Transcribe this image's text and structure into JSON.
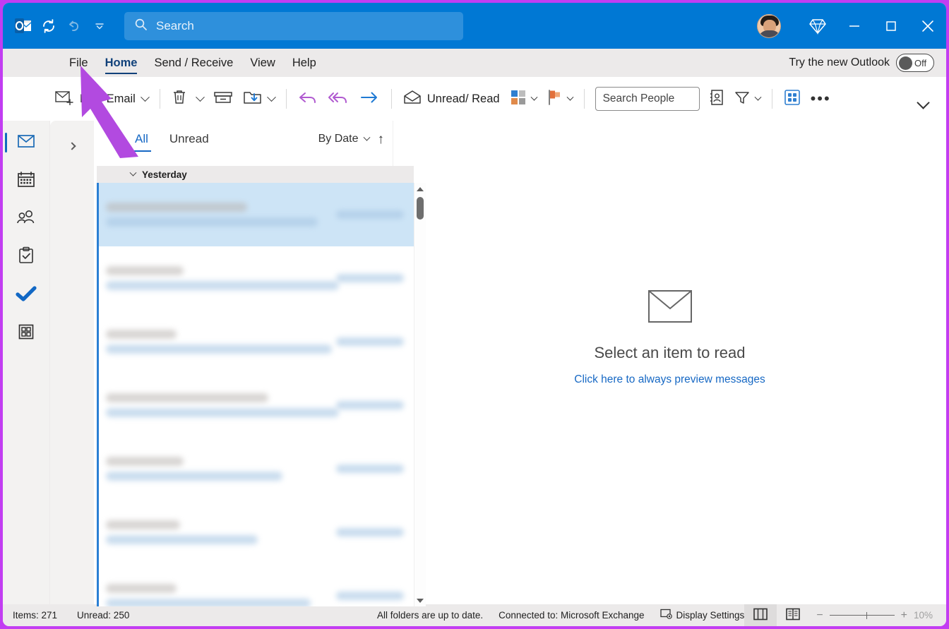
{
  "window": {
    "accent_border_color": "#c23df2",
    "titlebar_color": "#0078d4"
  },
  "titlebar": {
    "app_icon": "outlook-logo-icon",
    "sync_icon": "sync-refresh-icon",
    "undo_icon": "undo-icon",
    "qat_more_icon": "quick-access-chevron-icon",
    "search": {
      "placeholder": "Search",
      "value": "",
      "icon": "search-icon"
    },
    "account_avatar": "user-avatar",
    "diamond_icon": "diamond-premium-icon",
    "minimize_icon": "minimize-icon",
    "maximize_icon": "maximize-icon",
    "close_icon": "close-icon"
  },
  "ribbon_tabs": {
    "items": [
      {
        "label": "File",
        "active": false
      },
      {
        "label": "Home",
        "active": true
      },
      {
        "label": "Send / Receive",
        "active": false
      },
      {
        "label": "View",
        "active": false
      },
      {
        "label": "Help",
        "active": false
      }
    ],
    "try_new_outlook": {
      "label": "Try the new Outlook",
      "state": "Off"
    }
  },
  "ribbon": {
    "new_email": {
      "label": "New Email",
      "icon": "new-email-icon"
    },
    "delete": {
      "icon": "trash-icon"
    },
    "archive": {
      "icon": "archive-icon"
    },
    "move": {
      "icon": "move-to-folder-icon"
    },
    "reply": {
      "icon": "reply-icon"
    },
    "reply_all": {
      "icon": "reply-all-icon"
    },
    "forward": {
      "icon": "forward-arrow-icon"
    },
    "unread_read": {
      "label": "Unread/ Read",
      "icon": "open-envelope-icon"
    },
    "categorize": {
      "icon": "categorize-grid-icon"
    },
    "flag": {
      "icon": "flag-icon"
    },
    "search_people": {
      "placeholder": "Search People",
      "value": ""
    },
    "address_book": {
      "icon": "address-book-icon"
    },
    "filter_email": {
      "icon": "filter-funnel-icon"
    },
    "apps": {
      "icon": "apps-grid-icon"
    },
    "more_commands": {
      "icon": "ellipsis-icon"
    },
    "collapse_ribbon": {
      "icon": "chevron-down-icon"
    }
  },
  "navrail": {
    "items": [
      {
        "name": "mail",
        "icon": "mail-envelope-icon",
        "active": true
      },
      {
        "name": "calendar",
        "icon": "calendar-icon",
        "active": false
      },
      {
        "name": "people",
        "icon": "people-icon",
        "active": false
      },
      {
        "name": "tasks",
        "icon": "clipboard-check-icon",
        "active": false
      },
      {
        "name": "todo",
        "icon": "checkmark-icon",
        "active": false
      },
      {
        "name": "more-apps",
        "icon": "apps-grid-icon",
        "active": false
      }
    ]
  },
  "folder_pane": {
    "collapsed": true,
    "expand_icon": "chevron-right-icon"
  },
  "message_list": {
    "filter_tabs": [
      {
        "label": "All",
        "active": true
      },
      {
        "label": "Unread",
        "active": false
      }
    ],
    "sort": {
      "label": "By Date",
      "chevron_icon": "chevron-down-icon",
      "direction_icon": "arrow-up-icon"
    },
    "group_header": {
      "label": "Yesterday",
      "chevron_icon": "chevron-down-icon"
    },
    "rows": [
      {
        "selected": true,
        "unread": true,
        "sender_w": 200,
        "subject_w": 300,
        "preview_w": 0,
        "redacted": true
      },
      {
        "selected": false,
        "unread": true,
        "sender_w": 110,
        "subject_w": 330,
        "preview_w": 0,
        "redacted": true
      },
      {
        "selected": false,
        "unread": true,
        "sender_w": 100,
        "subject_w": 320,
        "preview_w": 0,
        "redacted": true
      },
      {
        "selected": false,
        "unread": true,
        "sender_w": 230,
        "subject_w": 330,
        "preview_w": 0,
        "redacted": true
      },
      {
        "selected": false,
        "unread": true,
        "sender_w": 110,
        "subject_w": 250,
        "preview_w": 0,
        "redacted": true
      },
      {
        "selected": false,
        "unread": true,
        "sender_w": 105,
        "subject_w": 215,
        "preview_w": 0,
        "redacted": true
      },
      {
        "selected": false,
        "unread": true,
        "sender_w": 100,
        "subject_w": 290,
        "preview_w": 0,
        "redacted": true
      }
    ],
    "scrollbar": {
      "up_icon": "scroll-up-arrow-icon",
      "down_icon": "scroll-down-arrow-icon"
    }
  },
  "reading_pane": {
    "empty_icon": "envelope-outline-icon",
    "title": "Select an item to read",
    "link": "Click here to always preview messages"
  },
  "statusbar": {
    "items_count": "Items: 271",
    "unread_count": "Unread: 250",
    "sync_status": "All folders are up to date.",
    "connection": "Connected to: Microsoft Exchange",
    "display_settings": {
      "label": "Display Settings",
      "icon": "display-settings-icon"
    },
    "normal_view_icon": "normal-view-icon",
    "reading_view_icon": "reading-view-icon",
    "zoom": {
      "minus": "−",
      "plus": "+",
      "value": "10%"
    }
  },
  "cursor": {
    "icon": "arrow-pointer-cursor",
    "color": "#b24ae0"
  }
}
